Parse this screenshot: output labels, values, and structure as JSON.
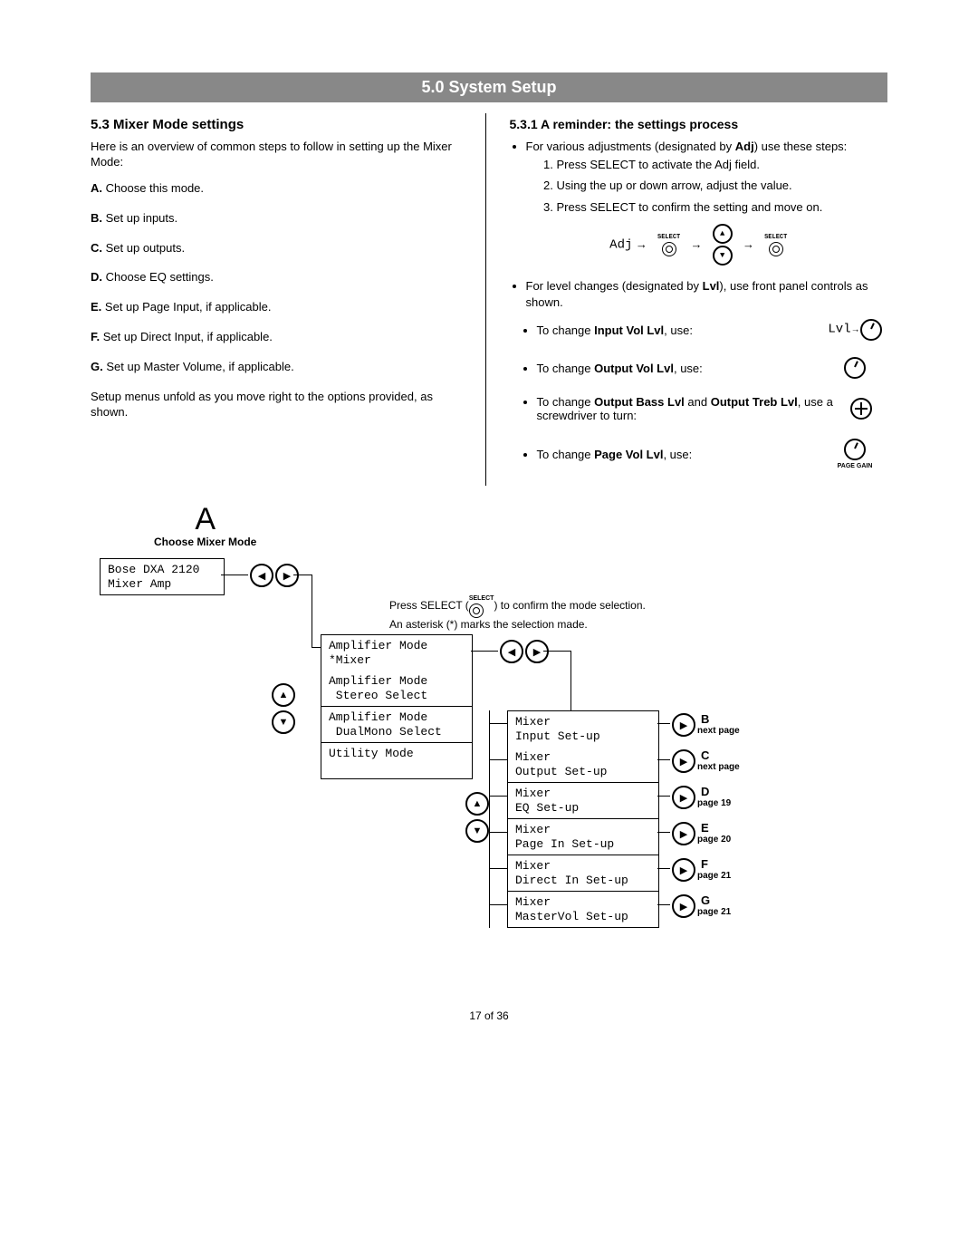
{
  "titleBar": "5.0 System Setup",
  "left": {
    "h2": "5.3 Mixer Mode settings",
    "intro": "Here is an overview of common steps to follow in setting up the Mixer Mode:",
    "steps": [
      {
        "l": "A.",
        "t": "Choose this mode."
      },
      {
        "l": "B.",
        "t": "Set up inputs."
      },
      {
        "l": "C.",
        "t": "Set up outputs."
      },
      {
        "l": "D.",
        "t": "Choose EQ settings."
      },
      {
        "l": "E.",
        "t": "Set up Page Input, if applicable."
      },
      {
        "l": "F.",
        "t": "Set up Direct Input, if applicable."
      },
      {
        "l": "G.",
        "t": "Set up Master Volume, if applicable."
      }
    ],
    "outro": "Setup menus unfold as you move right to the options provided, as shown."
  },
  "right": {
    "h3": "5.3.1 A reminder: the settings process",
    "adjIntro1": "For various adjustments (designated by ",
    "adjBold": "Adj",
    "adjIntro2": ") use these steps:",
    "adjSteps": [
      "Press SELECT to activate the Adj field.",
      "Using the up or down arrow, adjust the value.",
      "Press SELECT to confirm the setting and move on."
    ],
    "adjLabel": "Adj",
    "selectLabel": "SELECT",
    "lvlIntro1": "For level changes (designated by ",
    "lvlBold": "Lvl",
    "lvlIntro2": "), use front panel controls as shown.",
    "lvlLabel": "Lvl",
    "lvlItems": [
      {
        "pre": "To change ",
        "b": "Input Vol Lvl",
        "post": ", use:"
      },
      {
        "pre": "To change ",
        "b": "Output Vol Lvl",
        "post": ", use:"
      },
      {
        "pre": "To change ",
        "b": "Output Bass Lvl",
        "mid": " and ",
        "b2": "Output Treb Lvl",
        "post": ", use a screwdriver to turn:"
      },
      {
        "pre": "To change ",
        "b": "Page Vol Lvl",
        "post": ", use:"
      }
    ],
    "pageGainLabel": "PAGE GAIN"
  },
  "diagram": {
    "bigA": "A",
    "bigASub": "Choose Mixer Mode",
    "lcd1a": "Bose DXA 2120",
    "lcd1b": "Mixer Amp",
    "note1": "Press SELECT (",
    "note2": ") to confirm the mode selection.",
    "note3": "An asterisk (*) marks the selection made.",
    "modes": [
      {
        "a": "Amplifier Mode",
        "b": "*Mixer"
      },
      {
        "a": "Amplifier Mode",
        "b": " Stereo Select"
      },
      {
        "a": "Amplifier Mode",
        "b": " DualMono Select"
      },
      {
        "a": "Utility Mode",
        "b": ""
      }
    ],
    "mixerMenus": [
      {
        "a": "Mixer",
        "b": "Input Set-up",
        "lbl": "B",
        "pg": "next page"
      },
      {
        "a": "Mixer",
        "b": "Output Set-up",
        "lbl": "C",
        "pg": "next page"
      },
      {
        "a": "Mixer",
        "b": "EQ Set-up",
        "lbl": "D",
        "pg": "page 19"
      },
      {
        "a": "Mixer",
        "b": "Page In Set-up",
        "lbl": "E",
        "pg": "page 20"
      },
      {
        "a": "Mixer",
        "b": "Direct In Set-up",
        "lbl": "F",
        "pg": "page 21"
      },
      {
        "a": "Mixer",
        "b": "MasterVol Set-up",
        "lbl": "G",
        "pg": "page 21"
      }
    ]
  },
  "pageNum": "17 of 36"
}
